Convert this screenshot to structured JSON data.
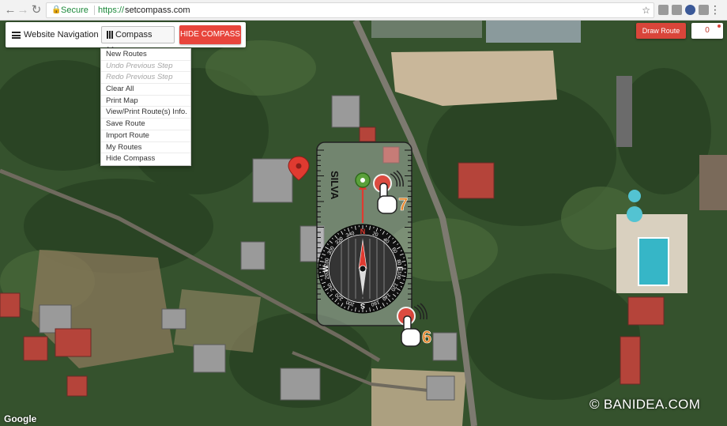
{
  "browser": {
    "secure_label": "Secure",
    "url_scheme": "https://",
    "url_host": "setcompass.com"
  },
  "toolbar": {
    "nav_label": "Website Navigation",
    "compass_menu_label": "Compass Menu",
    "hide_compass_label": "HIDE COMPASS"
  },
  "compass_menu": {
    "items": [
      {
        "label": "New Routes",
        "enabled": true
      },
      {
        "label": "Undo Previous Step",
        "enabled": false
      },
      {
        "label": "Redo Previous Step",
        "enabled": false
      },
      {
        "label": "Clear All",
        "enabled": true
      },
      {
        "label": "Print Map",
        "enabled": true
      },
      {
        "label": "View/Print Route(s) Info.",
        "enabled": true
      },
      {
        "label": "Save Route",
        "enabled": true
      },
      {
        "label": "Import Route",
        "enabled": true
      },
      {
        "label": "My Routes",
        "enabled": true
      },
      {
        "label": "Hide Compass",
        "enabled": true
      }
    ]
  },
  "route_controls": {
    "draw_route_label": "Draw Route",
    "route_count": "0"
  },
  "compass": {
    "brand": "SILVA",
    "cardinals": {
      "n": "N",
      "e": "E",
      "s": "S",
      "w": "W"
    },
    "degree_labels": [
      "20",
      "40",
      "60",
      "80",
      "100",
      "120",
      "140",
      "160",
      "200",
      "220",
      "240",
      "260",
      "280",
      "300",
      "320",
      "340"
    ]
  },
  "callouts": {
    "step_7": "7",
    "step_6": "6"
  },
  "map_attribution": "Google",
  "watermark": "© BANIDEA.COM",
  "colors": {
    "accent_red": "#e8453c",
    "secure_green": "#1e8a3c",
    "callout_orange": "#e8862a"
  }
}
